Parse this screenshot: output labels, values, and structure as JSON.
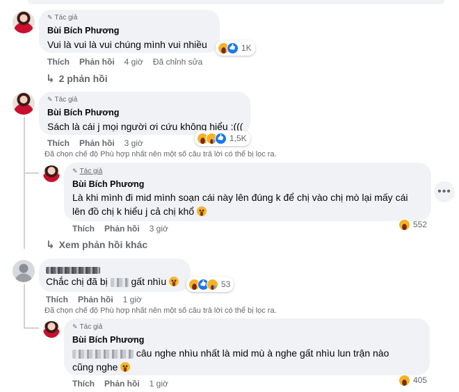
{
  "comments": [
    {
      "author_tag": "Tác giả",
      "name": "Bùi Bích Phương",
      "text": "Vui là vui là vui chúng mình vui nhiều",
      "reactions": {
        "icons": [
          "haha-icon",
          "like-icon"
        ],
        "count": "1K"
      },
      "actions": {
        "like": "Thích",
        "reply": "Phản hồi",
        "time": "4 giờ",
        "edited": "Đã chỉnh sửa"
      },
      "replies_link": "2 phản hồi"
    },
    {
      "author_tag": "Tác giả",
      "name": "Bùi Bích Phương",
      "text": "Sách là cái j mọi người ơi cứu không hiểu :(((",
      "reactions": {
        "icons": [
          "haha-icon",
          "sad-icon",
          "like-icon"
        ],
        "count": "1,5K"
      },
      "actions": {
        "like": "Thích",
        "reply": "Phản hồi",
        "time": "3 giờ"
      },
      "filter_note": "Đã chọn chế độ Phù hợp nhất nên một số câu trả lời có thể bị lọc ra.",
      "reply": {
        "author_tag": "Tác giả",
        "name": "Bùi Bích Phương",
        "text_line1": "Là khi mình đi mid mình soạn cái này lên đúng k để chị vào chị mò lại mấy cái",
        "text_line2": "lên đồ chị k hiểu j cả chị khổ",
        "reactions": {
          "icons": [
            "haha-icon"
          ],
          "count": "552"
        },
        "actions": {
          "like": "Thích",
          "reply": "Phản hồi",
          "time": "3 giờ"
        }
      },
      "more_replies_link": "Xem phản hồi khác"
    },
    {
      "text_before": "Chắc chị đã bị",
      "text_after": "gất nhìu",
      "reactions": {
        "icons": [
          "haha-icon",
          "like-icon",
          "sad-icon"
        ],
        "count": "53"
      },
      "actions": {
        "like": "Thích",
        "reply": "Phản hồi",
        "time": "1 giờ"
      },
      "filter_note": "Đã chọn chế độ Phù hợp nhất nên một số câu trả lời có thể bị lọc ra.",
      "reply": {
        "author_tag": "Tác giả",
        "name": "Bùi Bích Phương",
        "text_line1": "câu nghe nhìu nhất là mid mù à nghe gất nhìu lun trận nào",
        "text_line2": "cũng nghe",
        "reactions": {
          "icons": [
            "haha-icon"
          ],
          "count": "405"
        },
        "actions": {
          "like": "Thích",
          "reply": "Phản hồi",
          "time": "1 giờ"
        }
      }
    }
  ],
  "more_button": "•••",
  "colors": {
    "bubble": "#f0f2f5",
    "muted": "#65676b",
    "like_blue": "#1877f2",
    "haha_yellow": "#f7b125"
  }
}
